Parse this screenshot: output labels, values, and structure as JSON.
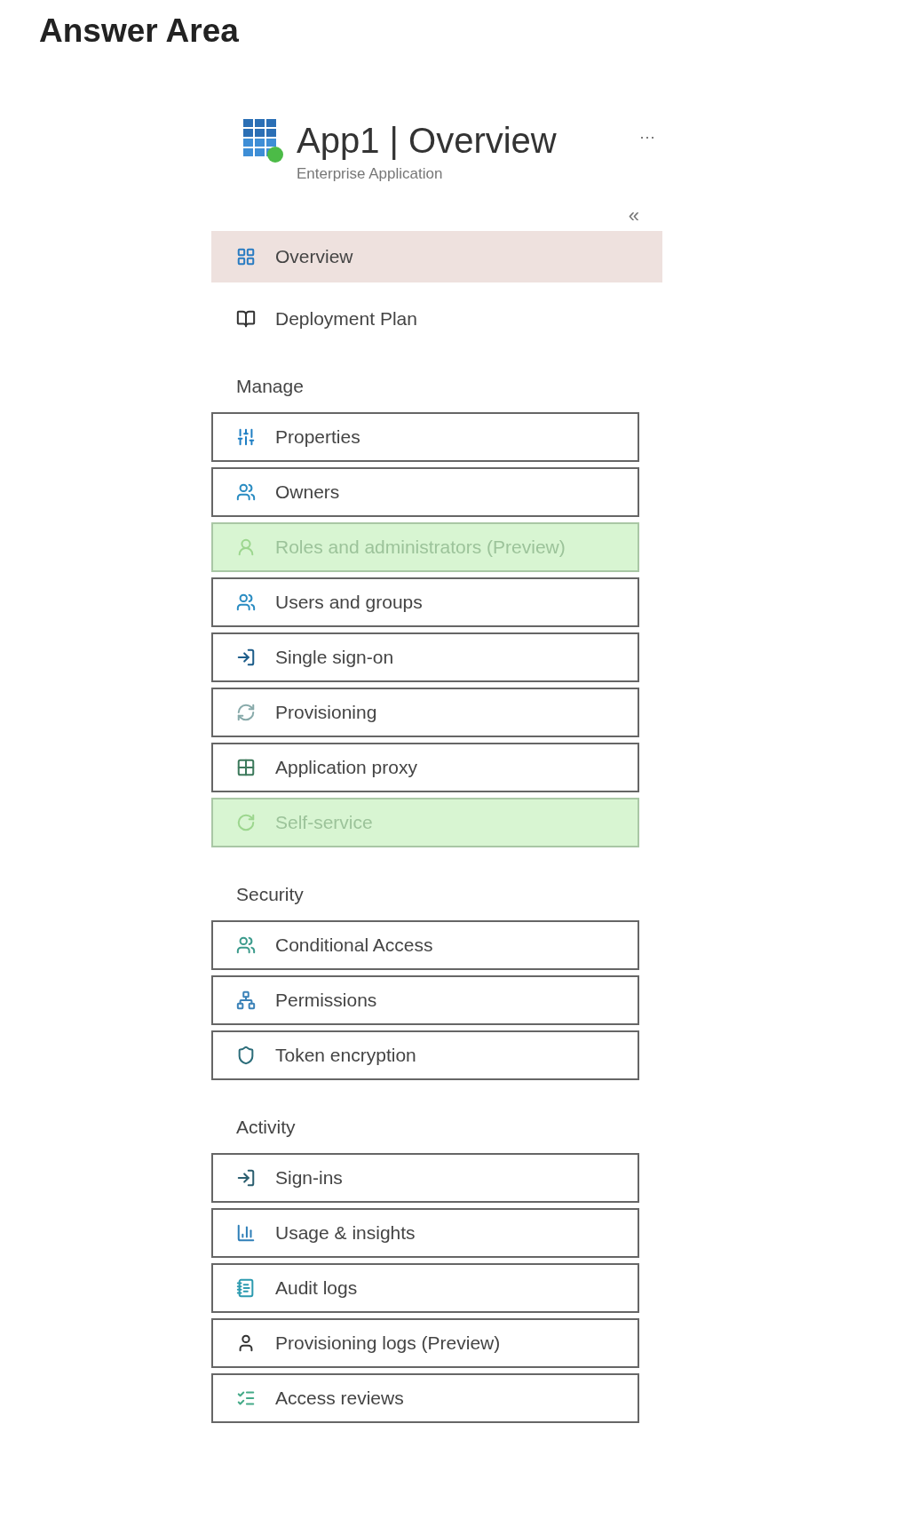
{
  "heading": "Answer Area",
  "blade": {
    "title": "App1 | Overview",
    "subtitle": "Enterprise Application",
    "more": "···",
    "collapse": "«"
  },
  "top_items": [
    {
      "label": "Overview",
      "selected": true
    },
    {
      "label": "Deployment Plan",
      "selected": false
    }
  ],
  "sections": [
    {
      "title": "Manage",
      "items": [
        {
          "label": "Properties",
          "marked": false
        },
        {
          "label": "Owners",
          "marked": false
        },
        {
          "label": "Roles and administrators (Preview)",
          "marked": true
        },
        {
          "label": "Users and groups",
          "marked": false
        },
        {
          "label": "Single sign-on",
          "marked": false
        },
        {
          "label": "Provisioning",
          "marked": false
        },
        {
          "label": "Application proxy",
          "marked": false
        },
        {
          "label": "Self-service",
          "marked": true
        }
      ]
    },
    {
      "title": "Security",
      "items": [
        {
          "label": "Conditional Access",
          "marked": false
        },
        {
          "label": "Permissions",
          "marked": false
        },
        {
          "label": "Token encryption",
          "marked": false
        }
      ]
    },
    {
      "title": "Activity",
      "items": [
        {
          "label": "Sign-ins",
          "marked": false
        },
        {
          "label": "Usage & insights",
          "marked": false
        },
        {
          "label": "Audit logs",
          "marked": false
        },
        {
          "label": "Provisioning logs (Preview)",
          "marked": false
        },
        {
          "label": "Access reviews",
          "marked": false
        }
      ]
    }
  ]
}
